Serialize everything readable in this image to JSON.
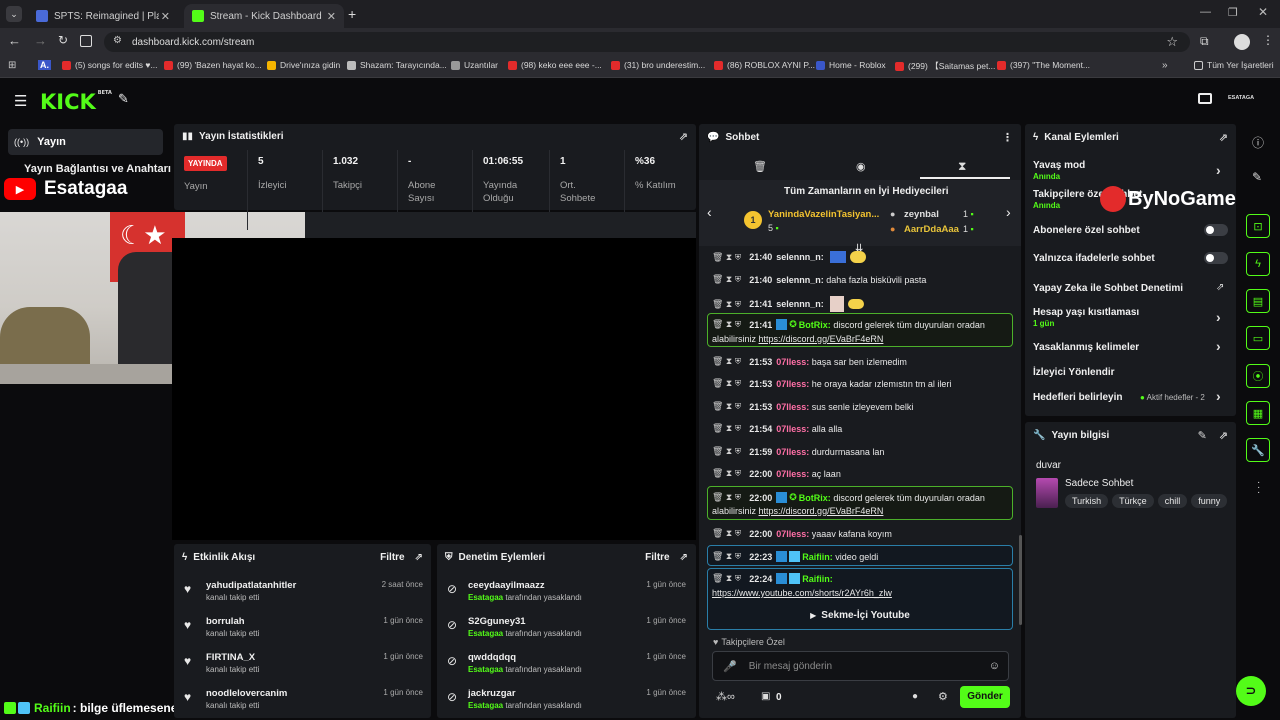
{
  "browser": {
    "tabs": [
      {
        "title": "SPTS: Reimagined | Play on",
        "active": false
      },
      {
        "title": "Stream - Kick Dashboard",
        "active": true
      }
    ],
    "url": "dashboard.kick.com/stream",
    "bookmarks": [
      "(5) songs for edits ♥...",
      "(99) 'Bazen hayat ko...",
      "Drive'ınıza gidin",
      "Shazam: Tarayıcında...",
      "Uzantılar",
      "(98) keko eee eee -...",
      "(31) bro underestim...",
      "(86) ROBLOX AYNI P...",
      "Home - Roblox",
      "(299) 【Saitamas pet...",
      "(397) \"The Moment..."
    ],
    "all_bookmarks": "Tüm Yer İşaretleri"
  },
  "nav": {
    "logo": "KICK",
    "logo_sup": "BETA",
    "avatar_label": "ESATAGA"
  },
  "sidebar": {
    "active_item": "Yayın",
    "item2": "Yayın Bağlantısı ve Anahtarı"
  },
  "overlay": {
    "channel_name": "Esatagaa",
    "watermark": "ByNoGame",
    "bottom_name": "Raifiin",
    "bottom_msg": ": bilge üflemesene"
  },
  "stats": {
    "title": "Yayın İstatistikleri",
    "live_badge": "YAYINDA",
    "live_label": "Yayın",
    "items": [
      {
        "value": "5",
        "label": "İzleyici"
      },
      {
        "value": "1.032",
        "label": "Takipçi"
      },
      {
        "value": "-",
        "label": "Abone Sayısı"
      },
      {
        "value": "01:06:55",
        "label": "Yayında Olduğu"
      },
      {
        "value": "1",
        "label": "Ort. Sohbete"
      },
      {
        "value": "%36",
        "label": "% Katılım"
      }
    ]
  },
  "chat": {
    "title": "Sohbet",
    "gifters_title": "Tüm Zamanların en İyi Hediyecileri",
    "gifters": [
      {
        "rank": "1",
        "name": "YanindaVazelinTasiyan...",
        "count": "5"
      },
      {
        "name": "zeynbal",
        "count": "1"
      },
      {
        "name": "AarrDdaAaa",
        "count": "1"
      }
    ],
    "messages": [
      {
        "time": "21:40",
        "user": "selennn_n:",
        "text": "",
        "color": "#e9e9e9"
      },
      {
        "time": "21:40",
        "user": "selennn_n:",
        "text": "daha fazla bisküvili pasta",
        "color": "#e9e9e9"
      },
      {
        "time": "21:41",
        "user": "selennn_n:",
        "text": "",
        "color": "#e9e9e9"
      },
      {
        "time": "21:53",
        "user": "07lless:",
        "text": "başa sar ben izlemedim",
        "color": "#ff6fa6"
      },
      {
        "time": "21:53",
        "user": "07lless:",
        "text": "he oraya kadar ızlemıstın tm al ileri",
        "color": "#ff6fa6"
      },
      {
        "time": "21:53",
        "user": "07lless:",
        "text": "sus senle izleyevem belki",
        "color": "#ff6fa6"
      },
      {
        "time": "21:54",
        "user": "07lless:",
        "text": "alla alla",
        "color": "#ff6fa6"
      },
      {
        "time": "21:59",
        "user": "07lless:",
        "text": "durdurmasana lan",
        "color": "#ff6fa6"
      },
      {
        "time": "22:00",
        "user": "07lless:",
        "text": "aç laan",
        "color": "#ff6fa6"
      },
      {
        "time": "22:00",
        "user": "07lless:",
        "text": "yaaav kafana koyım",
        "color": "#ff6fa6"
      }
    ],
    "bot1": {
      "time": "21:41",
      "user": "BotRix:",
      "text": "discord gelerek tüm duyuruları oradan",
      "text2": "alabilirsiniz",
      "link": "https://discord.gg/EVaBrF4eRN"
    },
    "bot2": {
      "time": "22:00",
      "user": "BotRix:",
      "text": "discord gelerek tüm duyuruları oradan",
      "text2": "alabilirsiniz",
      "link": "https://discord.gg/EVaBrF4eRN"
    },
    "raif1": {
      "time": "22:23",
      "user": "Raifiin:",
      "text": "video geldi"
    },
    "raif2": {
      "time": "22:24",
      "user": "Raifiin:",
      "link": "https://www.youtube.com/shorts/r2AYr6h_zlw",
      "button": "Sekme-İçi Youtube"
    },
    "followers_only": "Takipçilere Özel",
    "input_placeholder": "Bir mesaj gönderin",
    "count": "0",
    "send": "Gönder"
  },
  "channel_actions": {
    "title": "Kanal Eylemleri",
    "slow_mode": "Yavaş mod",
    "slow_mode_sub": "Anında",
    "followers_chat": "Takipçilere özel sohbet",
    "followers_chat_sub": "Anında",
    "subs_chat": "Abonelere özel sohbet",
    "emotes_chat": "Yalnızca ifadelerle sohbet",
    "ai_mod": "Yapay Zeka ile Sohbet Denetimi",
    "account_age": "Hesap yaşı kısıtlaması",
    "account_age_sub": "1 gün",
    "banned_words": "Yasaklanmış kelimeler",
    "redirect": "İzleyici Yönlendir",
    "goals": "Hedefleri belirleyin",
    "goals_sub": "Aktif hedefler - 2"
  },
  "stream_info": {
    "title": "Yayın bilgisi",
    "stream_title": "duvar",
    "category": "Sadece Sohbet",
    "tags": [
      "Turkish",
      "Türkçe",
      "chill",
      "funny"
    ]
  },
  "activity": {
    "title": "Etkinlik Akışı",
    "filter": "Filtre",
    "items": [
      {
        "name": "yahudipatlatanhitler",
        "sub": "kanalı takip etti",
        "time": "2 saat önce"
      },
      {
        "name": "borrulah",
        "sub": "kanalı takip etti",
        "time": "1 gün önce"
      },
      {
        "name": "FIRTINA_X",
        "sub": "kanalı takip etti",
        "time": "1 gün önce"
      },
      {
        "name": "noodlelovercanim",
        "sub": "kanalı takip etti",
        "time": "1 gün önce"
      }
    ]
  },
  "moderation": {
    "title": "Denetim Eylemleri",
    "filter": "Filtre",
    "by": "Esatagaa",
    "suffix": "tarafından yasaklandı",
    "items": [
      {
        "name": "ceeydaayilmaazz",
        "time": "1 gün önce"
      },
      {
        "name": "S2Gguney31",
        "time": "1 gün önce"
      },
      {
        "name": "qwddqdqq",
        "time": "1 gün önce"
      },
      {
        "name": "jackruzgar",
        "time": "1 gün önce"
      }
    ]
  },
  "colors": {
    "accent": "#53fc18",
    "live": "#e32b2b",
    "pink_user": "#ff6fa6",
    "bot": "#53fc18"
  }
}
